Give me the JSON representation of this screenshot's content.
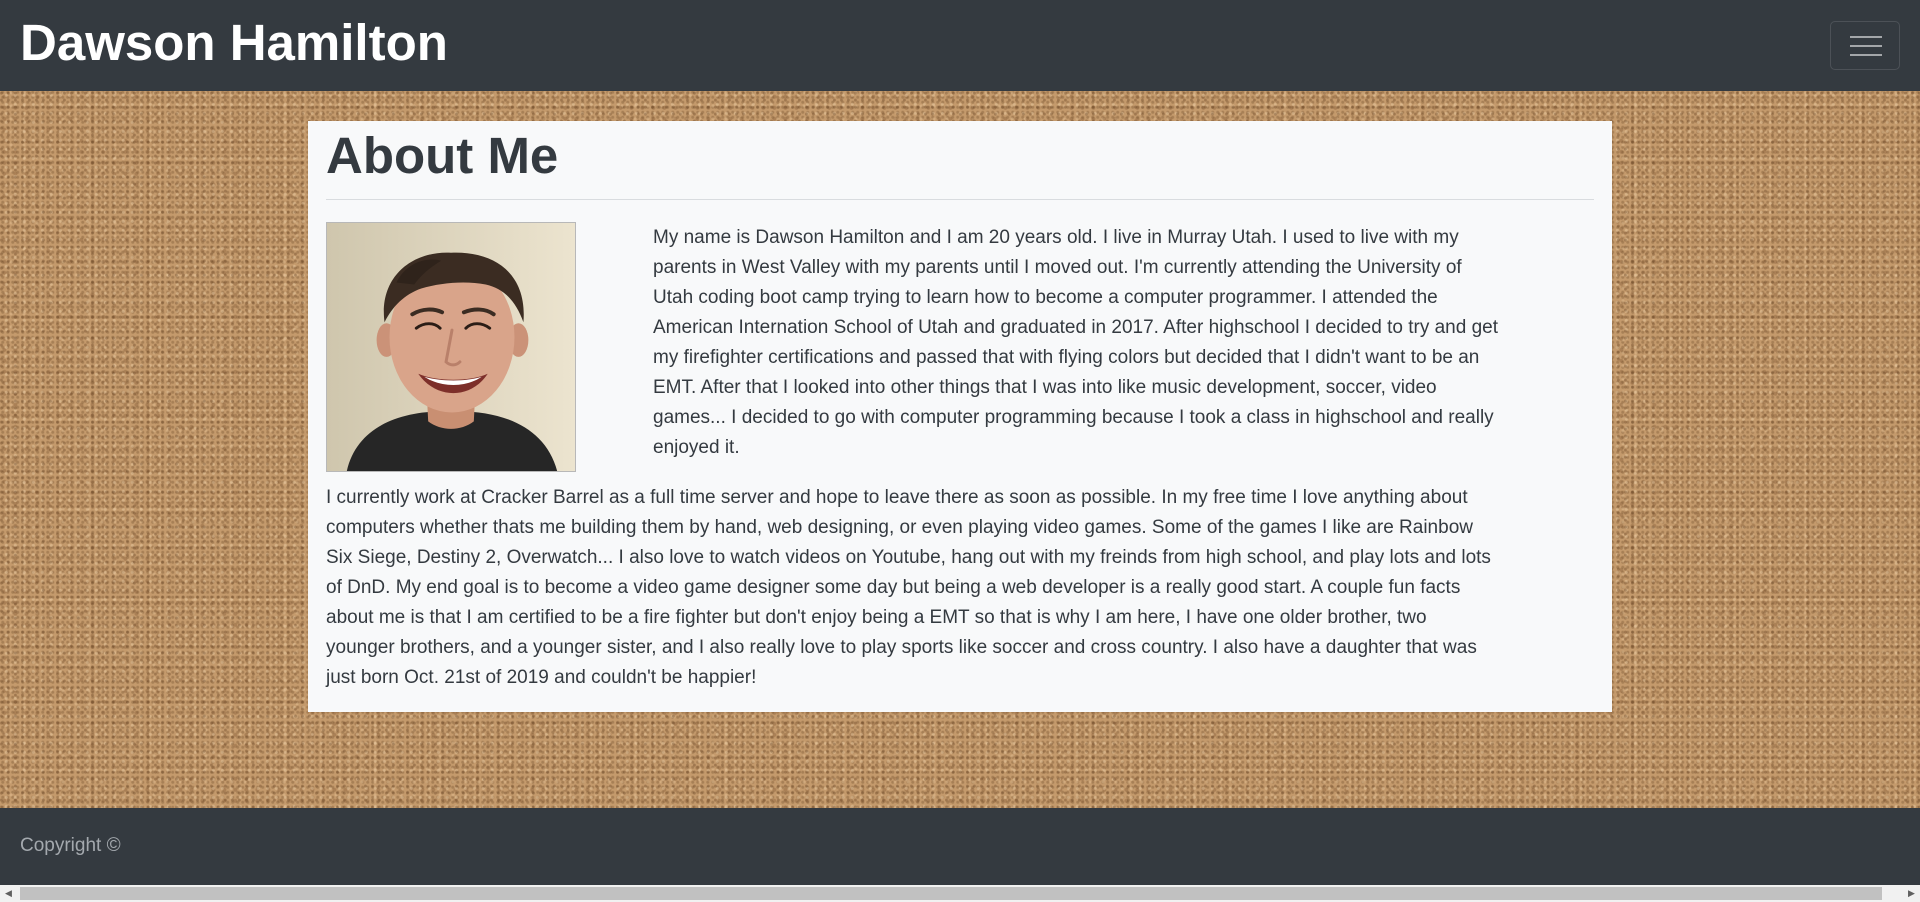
{
  "navbar": {
    "brand": "Dawson Hamilton",
    "toggler_icon": "hamburger-menu-icon"
  },
  "main": {
    "title": "About Me",
    "photo_icon": "profile-photo",
    "paragraphs": [
      "My name is Dawson Hamilton and I am 20 years old. I live in Murray Utah. I used to live with my parents in West Valley with my parents until I moved out. I'm currently attending the University of Utah coding boot camp trying to learn how to become a computer programmer. I attended the American Internation School of Utah and graduated in 2017. After highschool I decided to try and get my firefighter certifications and passed that with flying colors but decided that I didn't want to be an EMT. After that I looked into other things that I was into like music development, soccer, video games... I decided to go with computer programming because I took a class in highschool and really enjoyed it.",
      "I currently work at Cracker Barrel as a full time server and hope to leave there as soon as possible. In my free time I love anything about computers whether thats me building them by hand, web designing, or even playing video games. Some of the games I like are Rainbow Six Siege, Destiny 2, Overwatch... I also love to watch videos on Youtube, hang out with my freinds from high school, and play lots and lots of DnD. My end goal is to become a video game designer some day but being a web developer is a really good start. A couple fun facts about me is that I am certified to be a fire fighter but don't enjoy being a EMT so that is why I am here, I have one older brother, two younger brothers, and a younger sister, and I also really love to play sports like soccer and cross country. I also have a daughter that was just born Oct. 21st of 2019 and couldn't be happier!"
    ]
  },
  "footer": {
    "text": "Copyright ©"
  },
  "scrollbar": {
    "left_icon": "scroll-left-arrow-icon",
    "right_icon": "scroll-right-arrow-icon"
  },
  "colors": {
    "navbar_bg": "#343a40",
    "card_bg": "#f8f9fa",
    "text": "#343a40",
    "background_texture": "#c49a6c"
  }
}
